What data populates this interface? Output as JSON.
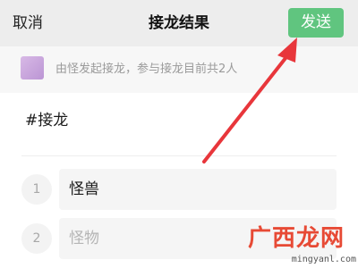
{
  "navbar": {
    "cancel_label": "取消",
    "title": "接龙结果",
    "send_label": "发送",
    "send_color": "#60c57f"
  },
  "info": {
    "avatar_color": "#c9a6dd",
    "text": "由怪发起接龙，参与接龙目前共2人"
  },
  "topic": "#接龙",
  "entries": [
    {
      "number": "1",
      "name": "怪兽"
    },
    {
      "number": "2",
      "name": "怪物"
    }
  ],
  "annotation": {
    "type": "red-arrow",
    "target": "send-button",
    "color": "#e8363b"
  },
  "watermark": {
    "text": "广西龙网",
    "url": "mingyanl.com"
  }
}
